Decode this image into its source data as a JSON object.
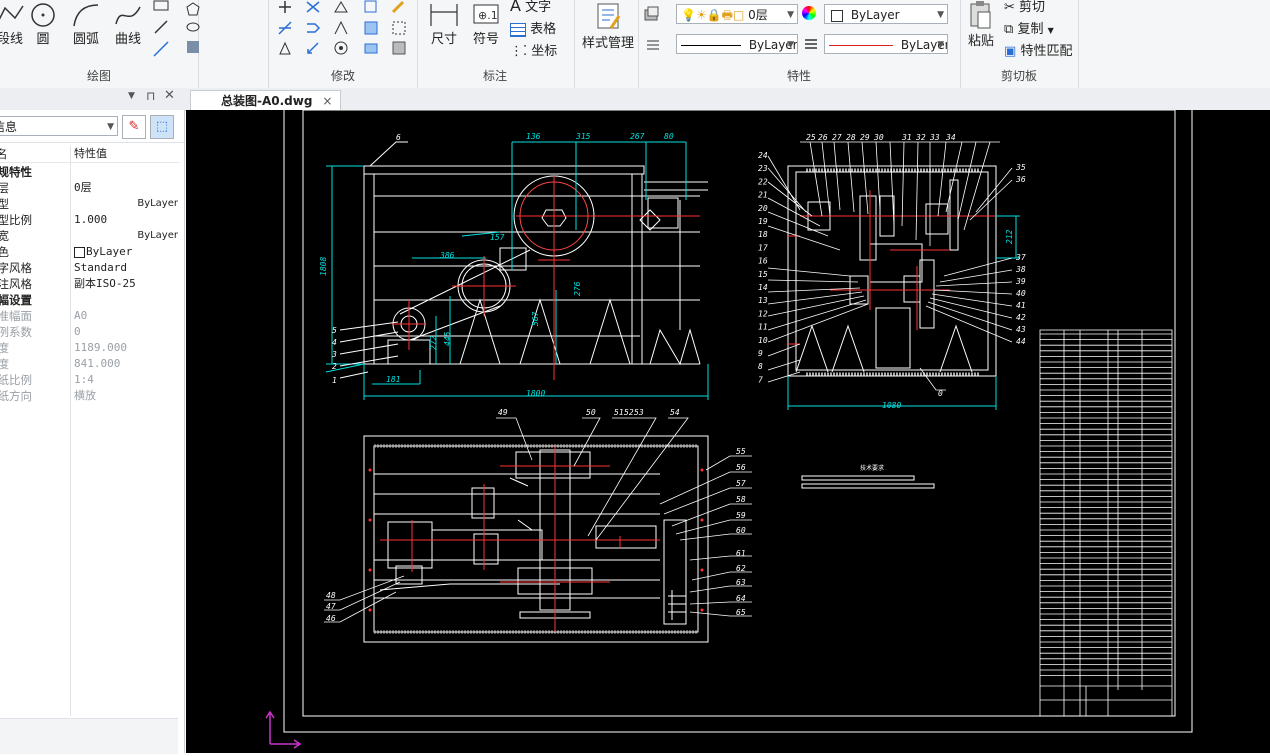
{
  "ribbon": {
    "draw": {
      "label": "绘图",
      "polyline_label": "段线",
      "circle_label": "圆",
      "arc_label": "圆弧",
      "spline_label": "曲线"
    },
    "modify": {
      "label": "修改"
    },
    "annotate": {
      "label": "标注",
      "dimension_label": "尺寸",
      "symbol_label": "符号",
      "text_label": "文字",
      "table_label": "表格",
      "coord_label": "坐标"
    },
    "style": {
      "style_manager_label": "样式管理"
    },
    "properties": {
      "label": "特性",
      "layer_value": "0层",
      "color_value": "ByLayer",
      "linetype_value": "ByLayer",
      "lineweight_value": "ByLayer"
    },
    "clipboard": {
      "label": "剪切板",
      "paste_label": "粘贴",
      "cut_label": "剪切",
      "copy_label": "复制",
      "match_label": "特性匹配"
    }
  },
  "doc_tab": {
    "title": "总装图-A0.dwg",
    "close": "×"
  },
  "properties_panel": {
    "selector_value": "信息",
    "col_name": "名",
    "col_value": "特性值",
    "rows": [
      {
        "k": "常规特性",
        "v": "",
        "type": "cat"
      },
      {
        "k": "图层",
        "v": "0层",
        "type": ""
      },
      {
        "k": "线型",
        "v": "ByLayer",
        "type": ""
      },
      {
        "k": "线型比例",
        "v": "1.000",
        "type": ""
      },
      {
        "k": "线宽",
        "v": "ByLayer",
        "type": ""
      },
      {
        "k": "颜色",
        "v": "ByLayer",
        "type": ""
      },
      {
        "k": "文字风格",
        "v": "Standard",
        "type": ""
      },
      {
        "k": "标注风格",
        "v": "副本ISO-25",
        "type": ""
      },
      {
        "k": "图幅设置",
        "v": "",
        "type": "cat"
      },
      {
        "k": "标准幅面",
        "v": "A0",
        "type": "gray"
      },
      {
        "k": "比例系数",
        "v": "0",
        "type": "gray"
      },
      {
        "k": "宽度",
        "v": "1189.000",
        "type": "gray"
      },
      {
        "k": "高度",
        "v": "841.000",
        "type": "gray"
      },
      {
        "k": "图纸比例",
        "v": "1:4",
        "type": "gray"
      },
      {
        "k": "图纸方向",
        "v": "横放",
        "type": "gray"
      }
    ]
  },
  "drawing": {
    "front": {
      "dims": [
        "136",
        "315",
        "267",
        "80",
        "1808",
        "386",
        "157",
        "567",
        "276",
        "272",
        "445",
        "181",
        "1800"
      ],
      "labels": [
        "6",
        "5",
        "4",
        "3",
        "2",
        "1"
      ]
    },
    "side": {
      "top_labels": [
        "25",
        "26",
        "27",
        "28",
        "29",
        "30",
        "31",
        "32",
        "33",
        "34"
      ],
      "left_labels": [
        "24",
        "23",
        "22",
        "21",
        "20",
        "19",
        "18",
        "17",
        "16",
        "15",
        "14",
        "13",
        "12",
        "11",
        "10",
        "9",
        "8",
        "7"
      ],
      "right_labels": [
        "35",
        "36",
        "37",
        "38",
        "39",
        "40",
        "41",
        "42",
        "43",
        "44"
      ],
      "dims": [
        "212",
        "1080"
      ],
      "bottom_label": "0"
    },
    "plan": {
      "top_labels": [
        "49",
        "50",
        "51",
        "52",
        "53",
        "54"
      ],
      "right_labels": [
        "55",
        "56",
        "57",
        "58",
        "59",
        "60",
        "61",
        "62",
        "63",
        "64",
        "65"
      ],
      "left_labels": [
        "48",
        "47",
        "46"
      ]
    },
    "note": "技术要求"
  }
}
